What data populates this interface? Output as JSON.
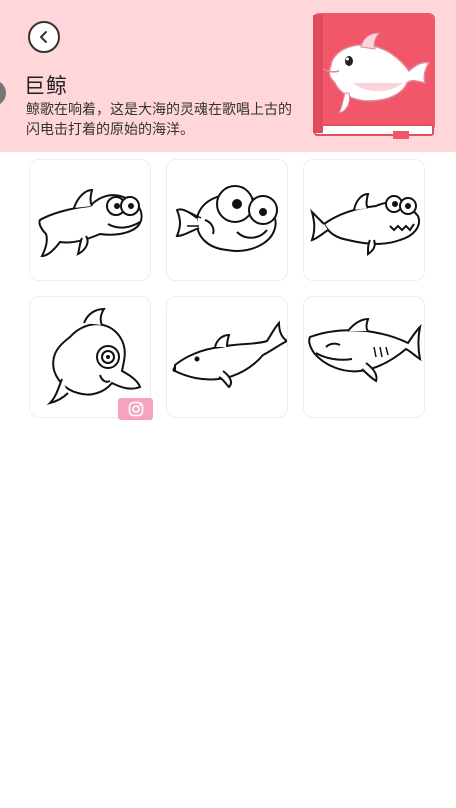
{
  "header": {
    "title": "巨鲸",
    "description": "鲸歌在响着，这是大海的灵魂在歌唱上古的闪电击打着的原始的海洋。",
    "background_color": "#ffd6da"
  },
  "icons": {
    "back": "chevron-left-icon",
    "book_cover": "dolphin-book-icon",
    "badge": "instagram-icon"
  },
  "items": [
    {
      "name": "cartoon-shark-big-eyes"
    },
    {
      "name": "cartoon-fish-big-eyes"
    },
    {
      "name": "cartoon-shark-toothy"
    },
    {
      "name": "cartoon-dolphin-swirl-eye"
    },
    {
      "name": "dolphin-leaping"
    },
    {
      "name": "shark-realistic"
    }
  ],
  "colors": {
    "book_red": "#f05a6e",
    "badge_pink": "#f4a3c0"
  }
}
